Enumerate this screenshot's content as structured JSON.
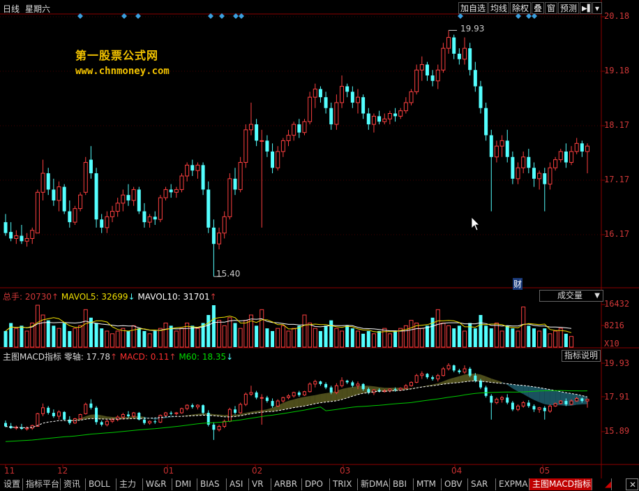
{
  "toolbar": {
    "period": "日线",
    "weekday": "星期六",
    "buttons": [
      "加自选",
      "均线",
      "除权",
      "叠",
      "窗",
      "预测"
    ],
    "pin_label": "▶▌",
    "menu_arrow": "▾"
  },
  "watermark": {
    "title": "第一股票公式网",
    "url": "www.chnmoney.com"
  },
  "price_axis": [
    "20.18",
    "19.18",
    "18.17",
    "17.17",
    "16.17"
  ],
  "annotations": {
    "high": "19.93",
    "low": "15.40",
    "finance_marker": "财"
  },
  "volume_panel": {
    "total_label": "总手: ",
    "total_value": "20730",
    "mavol5_label": "MAVOL5: ",
    "mavol5_value": "32699",
    "mavol10_label": "MAVOL10: ",
    "mavol10_value": "31701",
    "dropdown_value": "成交量",
    "axis": [
      "16432",
      "8216",
      "X10"
    ]
  },
  "indicator_panel": {
    "name": "主图MACD指标",
    "zero_label": "零轴: ",
    "zero_value": "17.78",
    "macd_label": "MACD: ",
    "macd_value": "0.11",
    "m60_label": "M60: ",
    "m60_value": "18.35",
    "help_button": "指标说明",
    "axis": [
      "19.93",
      "17.91",
      "15.89"
    ]
  },
  "x_axis": [
    "11",
    "12",
    "01",
    "02",
    "03",
    "04",
    "05"
  ],
  "tabs": [
    "设置",
    "指标平台",
    "资讯",
    "BOLL",
    "主力",
    "W&R",
    "DMI",
    "BIAS",
    "ASI",
    "VR",
    "ARBR",
    "DPO",
    "TRIX",
    "新DMA",
    "BBI",
    "MTM",
    "OBV",
    "SAR",
    "EXPMA",
    "主图MACD指标"
  ],
  "active_tab": "主图MACD指标",
  "colors": {
    "up": "#ff4040",
    "down": "#54ffff",
    "grid": "#8b0000",
    "label": "#c83030",
    "watermark": "#f2c300",
    "ma_white": "#ffffff",
    "ma_yellow": "#f0e000",
    "m60": "#00cc00"
  },
  "chart_data": {
    "type": "candlestick",
    "ylim": [
      15.2,
      20.3
    ],
    "candles": [
      {
        "o": 16.4,
        "h": 16.55,
        "l": 16.15,
        "c": 16.2
      },
      {
        "o": 16.22,
        "h": 16.4,
        "l": 16.05,
        "c": 16.1
      },
      {
        "o": 16.1,
        "h": 16.25,
        "l": 16.0,
        "c": 16.15
      },
      {
        "o": 16.15,
        "h": 16.35,
        "l": 16.0,
        "c": 16.05
      },
      {
        "o": 16.05,
        "h": 16.2,
        "l": 15.95,
        "c": 16.1
      },
      {
        "o": 16.1,
        "h": 16.3,
        "l": 16.0,
        "c": 16.25
      },
      {
        "o": 16.2,
        "h": 17.0,
        "l": 16.2,
        "c": 16.95
      },
      {
        "o": 16.95,
        "h": 17.55,
        "l": 16.8,
        "c": 17.3
      },
      {
        "o": 17.3,
        "h": 17.4,
        "l": 16.9,
        "c": 17.0
      },
      {
        "o": 17.0,
        "h": 17.2,
        "l": 16.7,
        "c": 16.8
      },
      {
        "o": 16.8,
        "h": 17.15,
        "l": 16.6,
        "c": 17.05
      },
      {
        "o": 17.05,
        "h": 17.1,
        "l": 16.55,
        "c": 16.6
      },
      {
        "o": 16.6,
        "h": 16.8,
        "l": 16.3,
        "c": 16.4
      },
      {
        "o": 16.4,
        "h": 16.7,
        "l": 16.35,
        "c": 16.65
      },
      {
        "o": 16.65,
        "h": 16.95,
        "l": 16.6,
        "c": 16.9
      },
      {
        "o": 16.95,
        "h": 17.6,
        "l": 16.9,
        "c": 17.5
      },
      {
        "o": 17.55,
        "h": 17.8,
        "l": 17.2,
        "c": 17.3
      },
      {
        "o": 17.3,
        "h": 17.4,
        "l": 16.3,
        "c": 16.45
      },
      {
        "o": 16.45,
        "h": 16.55,
        "l": 16.2,
        "c": 16.3
      },
      {
        "o": 16.3,
        "h": 16.6,
        "l": 16.2,
        "c": 16.5
      },
      {
        "o": 16.5,
        "h": 16.7,
        "l": 16.4,
        "c": 16.6
      },
      {
        "o": 16.6,
        "h": 16.85,
        "l": 16.5,
        "c": 16.75
      },
      {
        "o": 16.75,
        "h": 17.0,
        "l": 16.6,
        "c": 16.9
      },
      {
        "o": 16.9,
        "h": 17.1,
        "l": 16.7,
        "c": 16.8
      },
      {
        "o": 16.8,
        "h": 17.05,
        "l": 16.7,
        "c": 17.0
      },
      {
        "o": 17.0,
        "h": 17.05,
        "l": 16.55,
        "c": 16.6
      },
      {
        "o": 16.6,
        "h": 16.75,
        "l": 16.3,
        "c": 16.4
      },
      {
        "o": 16.4,
        "h": 16.55,
        "l": 16.3,
        "c": 16.5
      },
      {
        "o": 16.5,
        "h": 16.6,
        "l": 16.35,
        "c": 16.45
      },
      {
        "o": 16.45,
        "h": 16.9,
        "l": 16.4,
        "c": 16.85
      },
      {
        "o": 16.85,
        "h": 17.05,
        "l": 16.8,
        "c": 17.0
      },
      {
        "o": 17.0,
        "h": 17.1,
        "l": 16.85,
        "c": 16.95
      },
      {
        "o": 16.95,
        "h": 17.05,
        "l": 16.85,
        "c": 17.0
      },
      {
        "o": 17.0,
        "h": 17.3,
        "l": 16.95,
        "c": 17.25
      },
      {
        "o": 17.25,
        "h": 17.5,
        "l": 17.15,
        "c": 17.45
      },
      {
        "o": 17.45,
        "h": 17.55,
        "l": 17.25,
        "c": 17.35
      },
      {
        "o": 17.35,
        "h": 17.5,
        "l": 17.2,
        "c": 17.45
      },
      {
        "o": 17.45,
        "h": 17.5,
        "l": 16.9,
        "c": 17.0
      },
      {
        "o": 17.0,
        "h": 17.15,
        "l": 16.2,
        "c": 16.3
      },
      {
        "o": 16.3,
        "h": 16.45,
        "l": 15.4,
        "c": 16.0
      },
      {
        "o": 16.0,
        "h": 16.3,
        "l": 15.9,
        "c": 16.2
      },
      {
        "o": 16.2,
        "h": 16.6,
        "l": 16.1,
        "c": 16.5
      },
      {
        "o": 16.5,
        "h": 17.3,
        "l": 16.45,
        "c": 17.2
      },
      {
        "o": 17.2,
        "h": 17.4,
        "l": 16.9,
        "c": 17.0
      },
      {
        "o": 17.0,
        "h": 17.6,
        "l": 16.95,
        "c": 17.5
      },
      {
        "o": 17.5,
        "h": 18.2,
        "l": 17.4,
        "c": 18.1
      },
      {
        "o": 18.1,
        "h": 18.6,
        "l": 18.0,
        "c": 18.2
      },
      {
        "o": 18.2,
        "h": 18.3,
        "l": 17.8,
        "c": 17.9
      },
      {
        "o": 17.9,
        "h": 18.1,
        "l": 16.3,
        "c": 17.9
      },
      {
        "o": 17.9,
        "h": 18.0,
        "l": 17.6,
        "c": 17.7
      },
      {
        "o": 17.7,
        "h": 17.85,
        "l": 17.3,
        "c": 17.4
      },
      {
        "o": 17.4,
        "h": 17.8,
        "l": 17.35,
        "c": 17.7
      },
      {
        "o": 17.7,
        "h": 17.95,
        "l": 17.6,
        "c": 17.9
      },
      {
        "o": 17.9,
        "h": 18.1,
        "l": 17.8,
        "c": 18.0
      },
      {
        "o": 18.0,
        "h": 18.25,
        "l": 17.9,
        "c": 18.2
      },
      {
        "o": 18.2,
        "h": 18.3,
        "l": 17.95,
        "c": 18.05
      },
      {
        "o": 18.05,
        "h": 18.3,
        "l": 18.0,
        "c": 18.25
      },
      {
        "o": 18.25,
        "h": 18.8,
        "l": 18.2,
        "c": 18.7
      },
      {
        "o": 18.7,
        "h": 18.95,
        "l": 18.5,
        "c": 18.85
      },
      {
        "o": 18.85,
        "h": 18.9,
        "l": 18.6,
        "c": 18.7
      },
      {
        "o": 18.7,
        "h": 18.8,
        "l": 18.4,
        "c": 18.5
      },
      {
        "o": 18.5,
        "h": 18.6,
        "l": 18.1,
        "c": 18.2
      },
      {
        "o": 18.2,
        "h": 18.75,
        "l": 18.1,
        "c": 18.6
      },
      {
        "o": 18.6,
        "h": 19.1,
        "l": 18.5,
        "c": 18.9
      },
      {
        "o": 18.9,
        "h": 18.95,
        "l": 18.7,
        "c": 18.8
      },
      {
        "o": 18.8,
        "h": 18.9,
        "l": 18.5,
        "c": 18.6
      },
      {
        "o": 18.6,
        "h": 18.85,
        "l": 18.4,
        "c": 18.7
      },
      {
        "o": 18.7,
        "h": 18.75,
        "l": 18.3,
        "c": 18.4
      },
      {
        "o": 18.4,
        "h": 18.5,
        "l": 18.1,
        "c": 18.2
      },
      {
        "o": 18.2,
        "h": 18.4,
        "l": 18.05,
        "c": 18.35
      },
      {
        "o": 18.35,
        "h": 18.45,
        "l": 18.2,
        "c": 18.25
      },
      {
        "o": 18.25,
        "h": 18.4,
        "l": 18.2,
        "c": 18.3
      },
      {
        "o": 18.3,
        "h": 18.45,
        "l": 18.2,
        "c": 18.4
      },
      {
        "o": 18.4,
        "h": 18.5,
        "l": 18.25,
        "c": 18.35
      },
      {
        "o": 18.35,
        "h": 18.5,
        "l": 18.3,
        "c": 18.45
      },
      {
        "o": 18.45,
        "h": 18.7,
        "l": 18.4,
        "c": 18.6
      },
      {
        "o": 18.6,
        "h": 18.85,
        "l": 18.55,
        "c": 18.8
      },
      {
        "o": 18.8,
        "h": 19.3,
        "l": 18.75,
        "c": 19.2
      },
      {
        "o": 19.2,
        "h": 19.45,
        "l": 19.0,
        "c": 19.3
      },
      {
        "o": 19.3,
        "h": 19.35,
        "l": 19.0,
        "c": 19.1
      },
      {
        "o": 19.1,
        "h": 19.2,
        "l": 18.9,
        "c": 19.0
      },
      {
        "o": 19.0,
        "h": 19.3,
        "l": 18.85,
        "c": 19.2
      },
      {
        "o": 19.2,
        "h": 19.7,
        "l": 19.15,
        "c": 19.6
      },
      {
        "o": 19.6,
        "h": 19.93,
        "l": 19.5,
        "c": 19.8
      },
      {
        "o": 19.8,
        "h": 19.85,
        "l": 19.4,
        "c": 19.5
      },
      {
        "o": 19.5,
        "h": 19.6,
        "l": 19.3,
        "c": 19.4
      },
      {
        "o": 19.4,
        "h": 19.8,
        "l": 19.3,
        "c": 19.6
      },
      {
        "o": 19.6,
        "h": 19.7,
        "l": 19.1,
        "c": 19.2
      },
      {
        "o": 19.2,
        "h": 19.35,
        "l": 18.8,
        "c": 18.9
      },
      {
        "o": 18.9,
        "h": 19.0,
        "l": 18.4,
        "c": 18.5
      },
      {
        "o": 18.5,
        "h": 18.6,
        "l": 17.9,
        "c": 18.0
      },
      {
        "o": 18.0,
        "h": 18.1,
        "l": 16.6,
        "c": 17.6
      },
      {
        "o": 17.6,
        "h": 17.9,
        "l": 17.5,
        "c": 17.8
      },
      {
        "o": 17.8,
        "h": 18.0,
        "l": 17.6,
        "c": 17.9
      },
      {
        "o": 17.9,
        "h": 18.1,
        "l": 17.5,
        "c": 17.6
      },
      {
        "o": 17.6,
        "h": 17.7,
        "l": 17.1,
        "c": 17.2
      },
      {
        "o": 17.2,
        "h": 17.5,
        "l": 17.1,
        "c": 17.4
      },
      {
        "o": 17.4,
        "h": 17.7,
        "l": 17.3,
        "c": 17.6
      },
      {
        "o": 17.6,
        "h": 17.75,
        "l": 17.3,
        "c": 17.4
      },
      {
        "o": 17.4,
        "h": 17.5,
        "l": 17.05,
        "c": 17.2
      },
      {
        "o": 17.2,
        "h": 17.35,
        "l": 17.0,
        "c": 17.3
      },
      {
        "o": 17.3,
        "h": 17.4,
        "l": 16.6,
        "c": 17.1
      },
      {
        "o": 17.1,
        "h": 17.5,
        "l": 17.0,
        "c": 17.4
      },
      {
        "o": 17.4,
        "h": 17.6,
        "l": 17.35,
        "c": 17.55
      },
      {
        "o": 17.55,
        "h": 17.75,
        "l": 17.5,
        "c": 17.7
      },
      {
        "o": 17.7,
        "h": 17.85,
        "l": 17.4,
        "c": 17.5
      },
      {
        "o": 17.5,
        "h": 17.8,
        "l": 17.45,
        "c": 17.7
      },
      {
        "o": 17.7,
        "h": 17.95,
        "l": 17.65,
        "c": 17.85
      },
      {
        "o": 17.85,
        "h": 17.9,
        "l": 17.6,
        "c": 17.7
      },
      {
        "o": 17.7,
        "h": 17.85,
        "l": 17.3,
        "c": 17.8
      }
    ],
    "volume": [
      6,
      9,
      7,
      8,
      6,
      9,
      16,
      12,
      10,
      8,
      7,
      9,
      6,
      7,
      8,
      14,
      11,
      9,
      7,
      6,
      5,
      6,
      7,
      6,
      8,
      7,
      6,
      5,
      6,
      7,
      9,
      8,
      6,
      7,
      9,
      8,
      7,
      9,
      12,
      17,
      10,
      8,
      11,
      9,
      7,
      10,
      12,
      8,
      14,
      7,
      6,
      7,
      8,
      6,
      7,
      8,
      12,
      9,
      7,
      6,
      8,
      10,
      7,
      6,
      8,
      7,
      6,
      5,
      6,
      5,
      6,
      7,
      5,
      6,
      7,
      8,
      10,
      9,
      7,
      8,
      11,
      14,
      9,
      8,
      7,
      8,
      6,
      9,
      7,
      12,
      8,
      7,
      9,
      6,
      8,
      7,
      6,
      15,
      8,
      7,
      6,
      7,
      5,
      6,
      7,
      5,
      4
    ],
    "series_ma_white": [],
    "m60_desc": "rising line"
  }
}
